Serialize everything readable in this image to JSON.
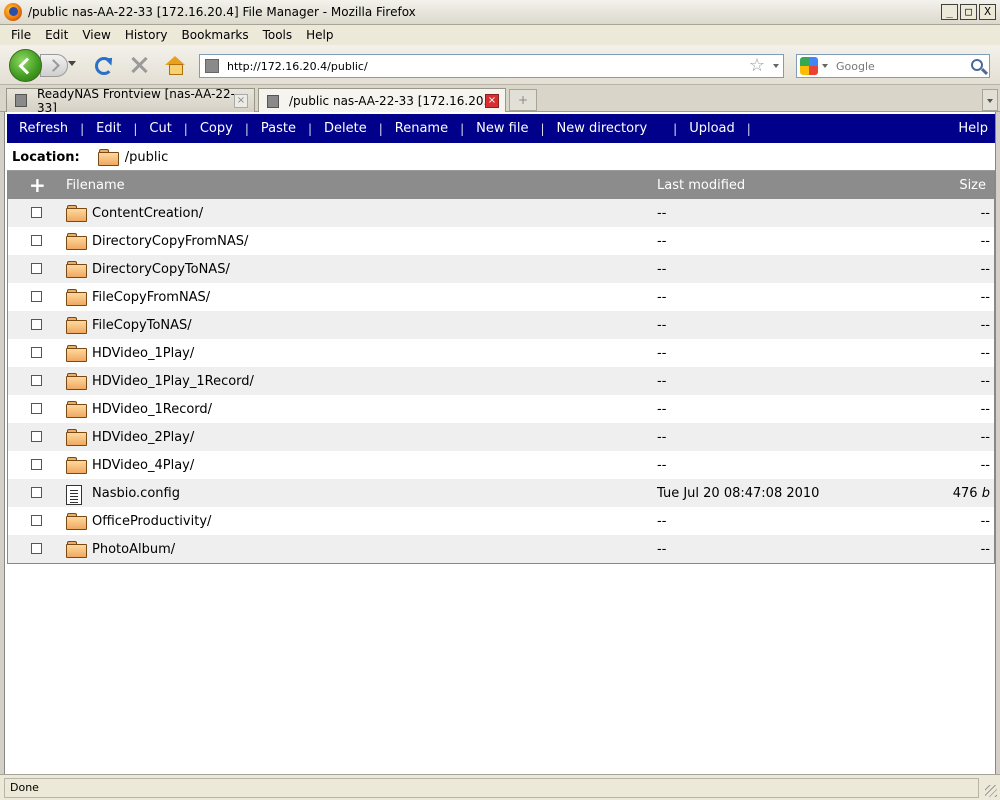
{
  "window": {
    "title": "/public nas-AA-22-33 [172.16.20.4] File Manager - Mozilla Firefox",
    "controls": [
      "_",
      "□",
      "X"
    ]
  },
  "menu": [
    "File",
    "Edit",
    "View",
    "History",
    "Bookmarks",
    "Tools",
    "Help"
  ],
  "nav": {
    "url": "http://172.16.20.4/public/",
    "search_placeholder": "Google"
  },
  "tabs": [
    {
      "label": "ReadyNAS Frontview [nas-AA-22-33]",
      "active": false
    },
    {
      "label": "/public nas-AA-22-33 [172.16.20....",
      "active": true
    }
  ],
  "new_tab_glyph": "+",
  "toolbar": {
    "items": [
      "Refresh",
      "Edit",
      "Cut",
      "Copy",
      "Paste",
      "Delete",
      "Rename",
      "New file",
      "New directory",
      "Upload"
    ],
    "separator": "|",
    "help": "Help"
  },
  "location": {
    "label": "Location:",
    "path": "/public"
  },
  "table": {
    "select_all": "+",
    "columns": {
      "name": "Filename",
      "modified": "Last modified",
      "size": "Size"
    },
    "rows": [
      {
        "type": "folder",
        "name": "ContentCreation/",
        "modified": "--",
        "size": "--",
        "unit": ""
      },
      {
        "type": "folder",
        "name": "DirectoryCopyFromNAS/",
        "modified": "--",
        "size": "--",
        "unit": ""
      },
      {
        "type": "folder",
        "name": "DirectoryCopyToNAS/",
        "modified": "--",
        "size": "--",
        "unit": ""
      },
      {
        "type": "folder",
        "name": "FileCopyFromNAS/",
        "modified": "--",
        "size": "--",
        "unit": ""
      },
      {
        "type": "folder",
        "name": "FileCopyToNAS/",
        "modified": "--",
        "size": "--",
        "unit": ""
      },
      {
        "type": "folder",
        "name": "HDVideo_1Play/",
        "modified": "--",
        "size": "--",
        "unit": ""
      },
      {
        "type": "folder",
        "name": "HDVideo_1Play_1Record/",
        "modified": "--",
        "size": "--",
        "unit": ""
      },
      {
        "type": "folder",
        "name": "HDVideo_1Record/",
        "modified": "--",
        "size": "--",
        "unit": ""
      },
      {
        "type": "folder",
        "name": "HDVideo_2Play/",
        "modified": "--",
        "size": "--",
        "unit": ""
      },
      {
        "type": "folder",
        "name": "HDVideo_4Play/",
        "modified": "--",
        "size": "--",
        "unit": ""
      },
      {
        "type": "file",
        "name": "Nasbio.config",
        "modified": "Tue Jul 20 08:47:08 2010",
        "size": "476",
        "unit": "b"
      },
      {
        "type": "folder",
        "name": "OfficeProductivity/",
        "modified": "--",
        "size": "--",
        "unit": ""
      },
      {
        "type": "folder",
        "name": "PhotoAlbum/",
        "modified": "--",
        "size": "--",
        "unit": ""
      }
    ]
  },
  "status": {
    "text": "Done"
  },
  "colors": {
    "toolbar_bg": "#00008b",
    "header_bg": "#8c8c8c",
    "row_alt": "#efefef"
  }
}
